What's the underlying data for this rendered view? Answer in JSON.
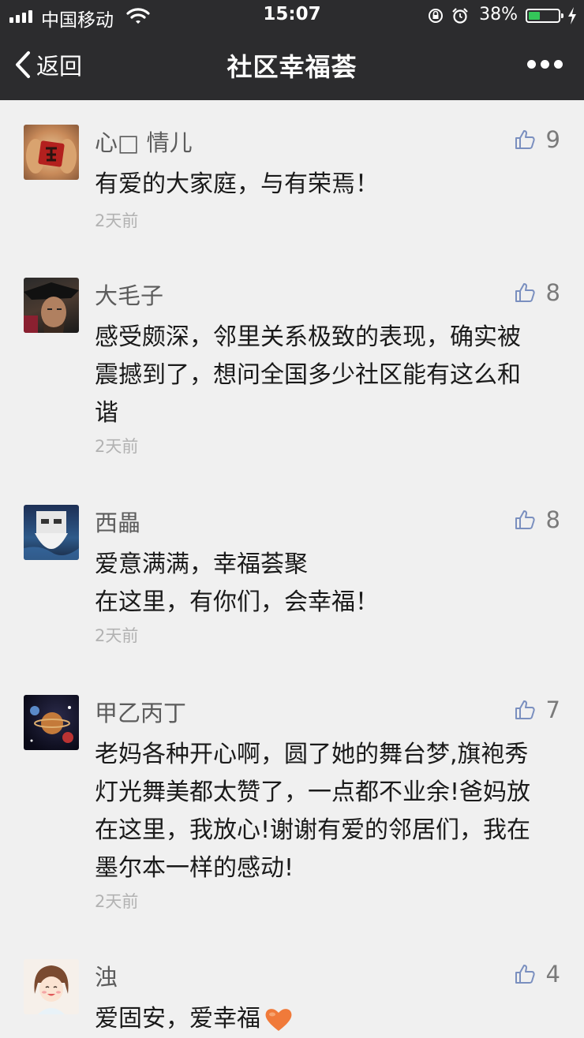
{
  "status_bar": {
    "carrier": "中国移动",
    "time": "15:07",
    "battery": "38%",
    "battery_level": 0.38
  },
  "nav": {
    "back_label": "返回",
    "title": "社区幸福荟"
  },
  "comments": [
    {
      "name": "心□ 情儿",
      "likes": "9",
      "lines": [
        "有爱的大家庭，与有荣焉！"
      ],
      "date": "2天前"
    },
    {
      "name": "大毛子",
      "likes": "8",
      "lines": [
        "感受颇深，邻里关系极致的表现，确实被",
        "震撼到了，想问全国多少社区能有这么和",
        "谐"
      ],
      "date": "2天前"
    },
    {
      "name": "西畾",
      "likes": "8",
      "lines": [
        "爱意满满，幸福荟聚",
        "在这里，有你们，会幸福！"
      ],
      "date": "2天前"
    },
    {
      "name": "甲乙丙丁",
      "likes": "7",
      "lines": [
        "老妈各种开心啊，圆了她的舞台梦,旗袍秀",
        "灯光舞美都太赞了，一点都不业余!爸妈放",
        "在这里，我放心!谢谢有爱的邻居们，我在",
        "墨尔本一样的感动!"
      ],
      "date": "2天前"
    },
    {
      "name": "浊",
      "likes": "4",
      "lines": [
        "爱固安，爱幸福"
      ],
      "date": ""
    }
  ],
  "colors": {
    "header_bg": "#2c2c2e",
    "page_bg": "#f0f0f0",
    "battery_fill": "#34c759"
  }
}
